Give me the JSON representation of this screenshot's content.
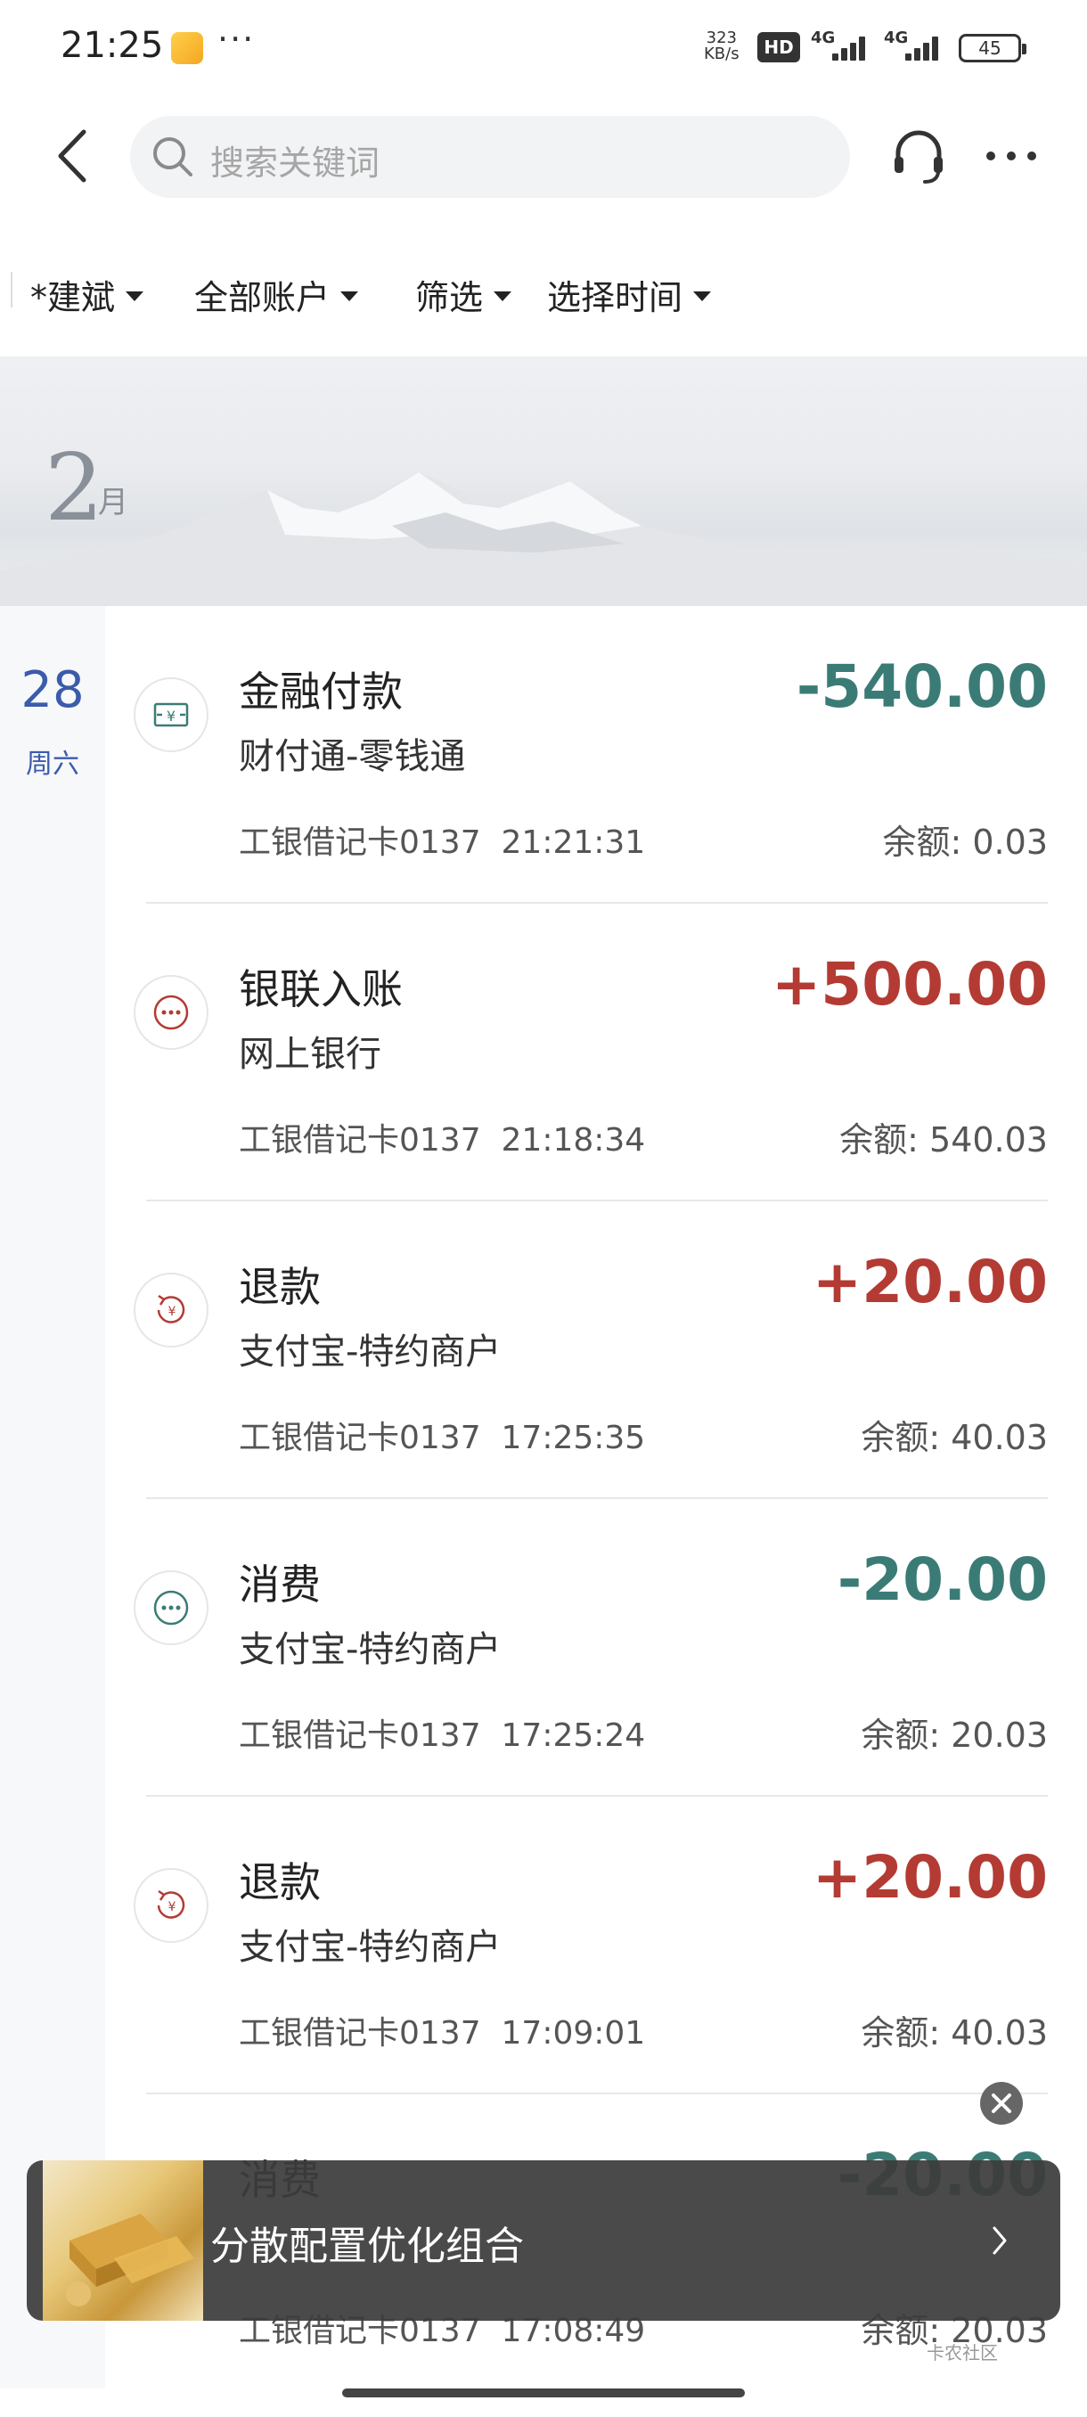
{
  "status_bar": {
    "time": "21:25",
    "dots": "···",
    "net_speed_value": "323",
    "net_speed_unit": "KB/s",
    "hd": "HD",
    "signal_1": "4G",
    "signal_2": "4G",
    "battery": "45"
  },
  "search": {
    "placeholder": "搜索关键词"
  },
  "filters": [
    {
      "label": "*建斌"
    },
    {
      "label": "全部账户"
    },
    {
      "label": "筛选"
    },
    {
      "label": "选择时间"
    }
  ],
  "month": {
    "number": "2",
    "unit": "月"
  },
  "date": {
    "day": "28",
    "weekday": "周六"
  },
  "transactions": [
    {
      "title": "金融付款",
      "counterparty": "财付通-零钱通",
      "account": "工银借记卡0137",
      "time": "21:21:31",
      "amount": "-540.00",
      "balance": "余额: 0.03",
      "icon": "transfer-icon"
    },
    {
      "title": "银联入账",
      "counterparty": "网上银行",
      "account": "工银借记卡0137",
      "time": "21:18:34",
      "amount": "+500.00",
      "balance": "余额: 540.03",
      "icon": "dots-icon"
    },
    {
      "title": "退款",
      "counterparty": "支付宝-特约商户",
      "account": "工银借记卡0137",
      "time": "17:25:35",
      "amount": "+20.00",
      "balance": "余额: 40.03",
      "icon": "refund-icon"
    },
    {
      "title": "消费",
      "counterparty": "支付宝-特约商户",
      "account": "工银借记卡0137",
      "time": "17:25:24",
      "amount": "-20.00",
      "balance": "余额: 20.03",
      "icon": "dots-icon"
    },
    {
      "title": "退款",
      "counterparty": "支付宝-特约商户",
      "account": "工银借记卡0137",
      "time": "17:09:01",
      "amount": "+20.00",
      "balance": "余额: 40.03",
      "icon": "refund-icon"
    },
    {
      "title": "消费",
      "counterparty": "",
      "account": "工银借记卡0137",
      "time": "17:08:49",
      "amount": "-20.00",
      "balance": "余额: 20.03",
      "icon": "dots-icon"
    }
  ],
  "ad": {
    "text": "分散配置优化组合"
  },
  "watermark": "卡农社区",
  "colors": {
    "negative": "#3b7b76",
    "positive": "#b33b33",
    "date_blue": "#3b5bab"
  }
}
